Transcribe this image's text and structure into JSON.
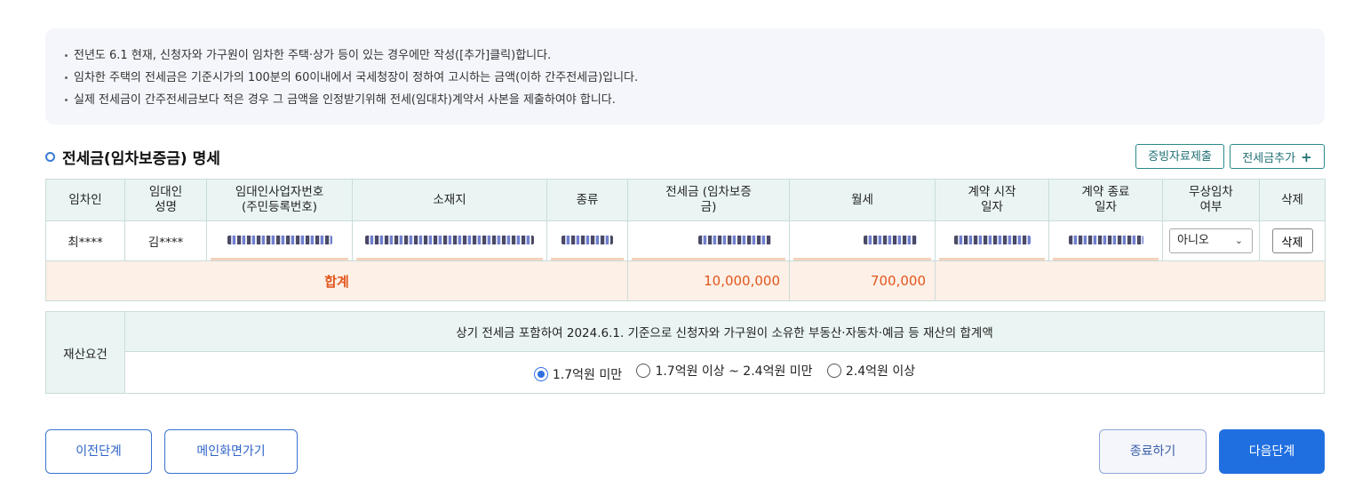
{
  "notice": {
    "lines": [
      "전년도 6.1 현재, 신청자와 가구원이 임차한 주택·상가 등이 있는 경우에만 작성([추가]클릭)합니다.",
      "임차한 주택의 전세금은 기준시가의 100분의 60이내에서 국세청장이 정하여 고시하는 금액(이하 간주전세금)입니다.",
      "실제 전세금이 간주전세금보다 적은 경우 그 금액을 인정받기위해 전세(임대차)계약서 사본을 제출하여야 합니다."
    ]
  },
  "section": {
    "title": "전세금(임차보증금) 명세",
    "evidence_button": "증빙자료제출",
    "add_button": "전세금추가",
    "add_icon": "plus-icon"
  },
  "table": {
    "headers": {
      "tenant": "임차인",
      "lessor_name": "임대인 성명",
      "lessor_id": "임대인사업자번호 (주민등록번호)",
      "address": "소재지",
      "type": "종류",
      "deposit": "전세금 (임차보증금)",
      "monthly_rent": "월세",
      "contract_start": "계약 시작일자",
      "contract_end": "계약 종료일자",
      "free_lease": "무상임차 여부",
      "delete": "삭제"
    },
    "rows": [
      {
        "tenant": "최****",
        "lessor_name": "김****",
        "free_lease": "아니오",
        "delete_label": "삭제"
      }
    ],
    "total": {
      "label": "합계",
      "deposit": "10,000,000",
      "monthly_rent": "700,000"
    }
  },
  "asset": {
    "label": "재산요건",
    "description": "상기 전세금 포함하여 2024.6.1. 기준으로 신청자와 가구원이 소유한 부동산·자동차·예금 등 재산의 합계액",
    "options": [
      "1.7억원 미만",
      "1.7억원 이상 ~ 2.4억원 미만",
      "2.4억원 이상"
    ],
    "selected": "1.7억원 미만"
  },
  "footer": {
    "prev": "이전단계",
    "main": "메인화면가기",
    "end": "종료하기",
    "next": "다음단계"
  },
  "colors": {
    "accent": "#1f6fe0",
    "header_bg": "#eaf5f3",
    "total_bg": "#fdf0e6",
    "total_text": "#e2561d",
    "teal": "#2b8a8a"
  }
}
